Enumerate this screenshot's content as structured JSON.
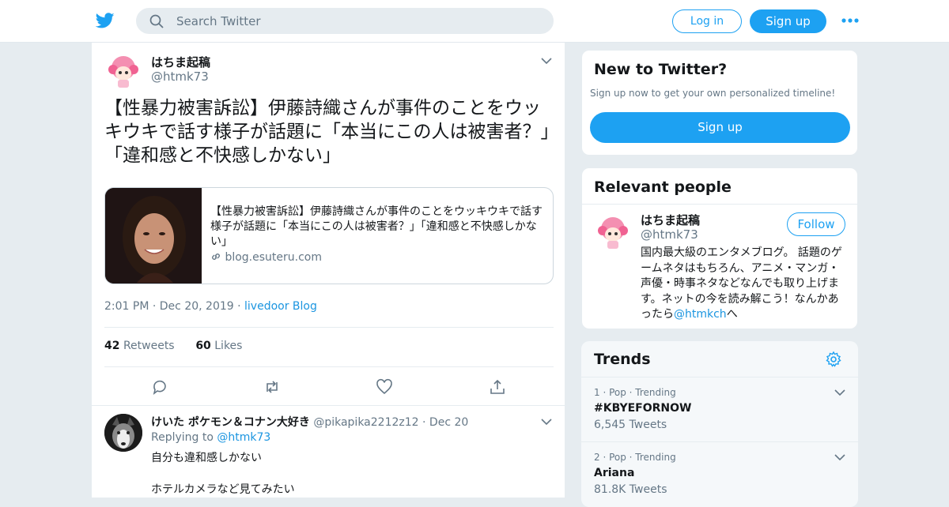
{
  "topbar": {
    "search_placeholder": "Search Twitter",
    "login_label": "Log in",
    "signup_label": "Sign up"
  },
  "tweet": {
    "author_name": "はちま起稿",
    "author_handle": "@htmk73",
    "text": "【性暴力被害訴訟】伊藤詩織さんが事件のことをウッキウキで話す様子が話題に「本当にこの人は被害者？」「違和感と不快感しかない」",
    "card": {
      "title": "【性暴力被害訴訟】伊藤詩織さんが事件のことをウッキウキで話す様子が話題に「本当にこの人は被害者？」「違和感と不快感しかない」",
      "domain": "blog.esuteru.com"
    },
    "time": "2:01 PM",
    "date": "Dec 20, 2019",
    "via": "livedoor Blog",
    "retweets": "42",
    "retweets_label": "Retweets",
    "likes": "60",
    "likes_label": "Likes"
  },
  "reply": {
    "author_name": "けいた ポケモン＆コナン大好き",
    "author_handle": "@pikapika2212z12",
    "date": "Dec 20",
    "replying_label": "Replying to",
    "replying_to": "@htmk73",
    "line1": "自分も違和感しかない",
    "line2": "ホテルカメラなど見てみたい"
  },
  "sidebar": {
    "new_title": "New to Twitter?",
    "new_sub": "Sign up now to get your own personalized timeline!",
    "new_button": "Sign up",
    "relevant_title": "Relevant people",
    "person": {
      "name": "はちま起稿",
      "handle": "@htmk73",
      "follow_label": "Follow",
      "bio": "国内最大級のエンタメブログ。 話題のゲームネタはもちろん、アニメ・マンガ・声優・時事ネタなどなんでも取り上げます。ネットの今を読み解こう！なんかあったら",
      "bio_link": "@htmkch",
      "bio_tail": "へ"
    },
    "trends_title": "Trends",
    "trends": [
      {
        "context": "1 · Pop · Trending",
        "name": "#KBYEFORNOW",
        "count": "6,545 Tweets"
      },
      {
        "context": "2 · Pop · Trending",
        "name": "Ariana",
        "count": "81.8K Tweets"
      }
    ]
  },
  "colors": {
    "brand": "#1da1f2",
    "link": "#1b95e0",
    "muted": "#657786"
  },
  "icons": [
    "twitter-bird-icon",
    "search-icon",
    "more-dots-icon",
    "chevron-down-icon",
    "link-icon",
    "reply-icon",
    "retweet-icon",
    "like-icon",
    "share-icon",
    "gear-icon"
  ]
}
